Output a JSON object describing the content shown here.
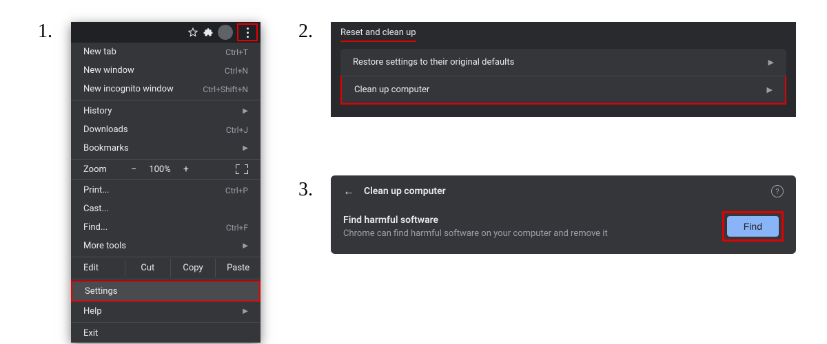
{
  "steps": {
    "one": "1.",
    "two": "2.",
    "three": "3."
  },
  "step1": {
    "menu": {
      "new_tab": {
        "label": "New tab",
        "shortcut": "Ctrl+T"
      },
      "new_window": {
        "label": "New window",
        "shortcut": "Ctrl+N"
      },
      "incognito": {
        "label": "New incognito window",
        "shortcut": "Ctrl+Shift+N"
      },
      "history": {
        "label": "History"
      },
      "downloads": {
        "label": "Downloads",
        "shortcut": "Ctrl+J"
      },
      "bookmarks": {
        "label": "Bookmarks"
      },
      "zoom": {
        "label": "Zoom",
        "minus": "−",
        "value": "100%",
        "plus": "+"
      },
      "print": {
        "label": "Print...",
        "shortcut": "Ctrl+P"
      },
      "cast": {
        "label": "Cast..."
      },
      "find": {
        "label": "Find...",
        "shortcut": "Ctrl+F"
      },
      "more_tools": {
        "label": "More tools"
      },
      "edit": {
        "label": "Edit",
        "cut": "Cut",
        "copy": "Copy",
        "paste": "Paste"
      },
      "settings": {
        "label": "Settings"
      },
      "help": {
        "label": "Help"
      },
      "exit": {
        "label": "Exit"
      }
    }
  },
  "step2": {
    "title": "Reset and clean up",
    "item1": "Restore settings to their original defaults",
    "item2": "Clean up computer"
  },
  "step3": {
    "title": "Clean up computer",
    "heading": "Find harmful software",
    "desc": "Chrome can find harmful software on your computer and remove it",
    "find_label": "Find",
    "help": "?"
  }
}
